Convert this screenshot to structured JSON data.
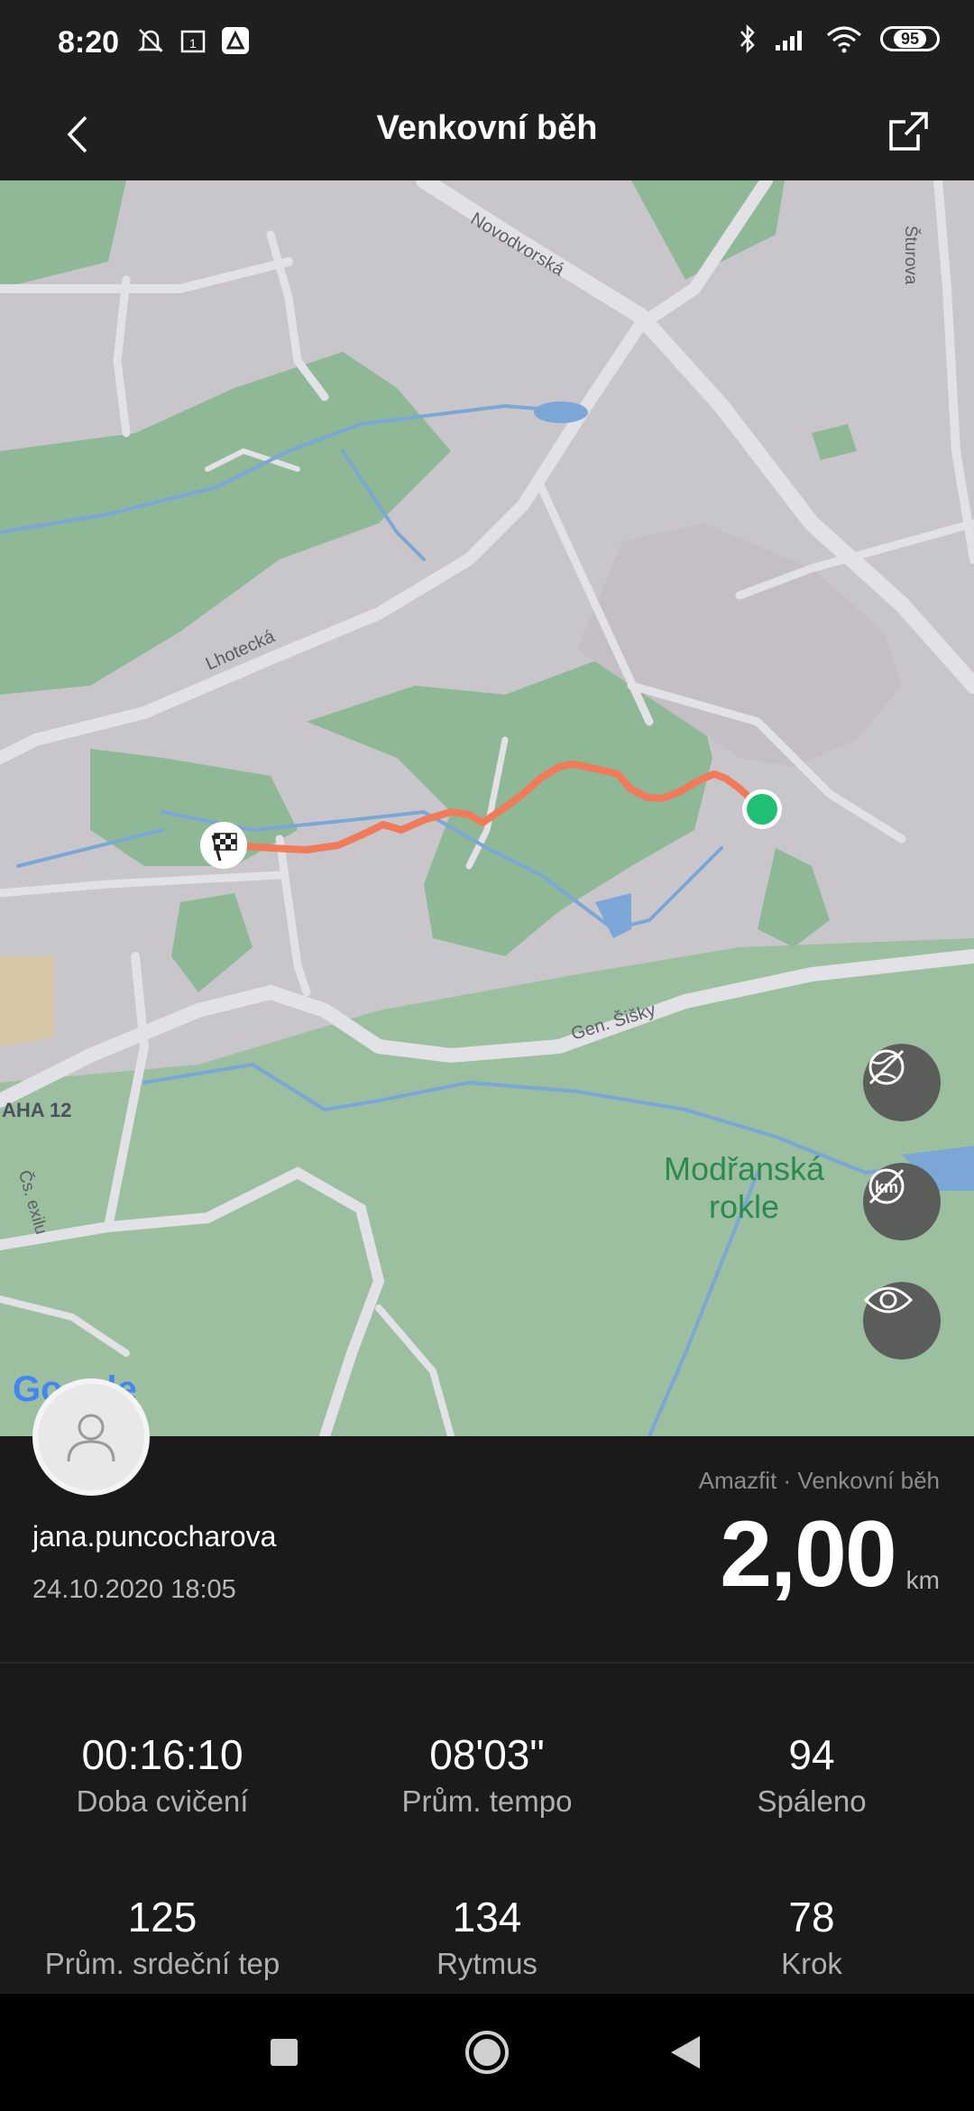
{
  "status_bar": {
    "time": "8:20",
    "battery": "95"
  },
  "header": {
    "title": "Venkovní běh"
  },
  "map": {
    "street_labels": [
      "Novodvorská",
      "Šturova",
      "Lhotecká",
      "Gen. Šišky",
      "AHA 12",
      "Čs. exilu"
    ],
    "park_label": "Modřanská rokle",
    "google_logo": "Google",
    "controls": [
      "satellite-toggle-icon",
      "km-markers-toggle-icon",
      "visibility-icon"
    ],
    "route_color": "#f07a5a",
    "start_color": "#1fbf74"
  },
  "summary": {
    "username": "jana.puncocharova",
    "datetime": "24.10.2020 18:05",
    "source": "Amazfit · Venkovní běh",
    "distance_value": "2,00",
    "distance_unit": "km"
  },
  "stats": [
    {
      "value": "00:16:10",
      "label": "Doba cvičení"
    },
    {
      "value": "08'03\"",
      "label": "Prům. tempo"
    },
    {
      "value": "94",
      "label": "Spáleno"
    },
    {
      "value": "125",
      "label": "Prům. srdeční tep"
    },
    {
      "value": "134",
      "label": "Rytmus"
    },
    {
      "value": "78",
      "label": "Krok"
    }
  ]
}
